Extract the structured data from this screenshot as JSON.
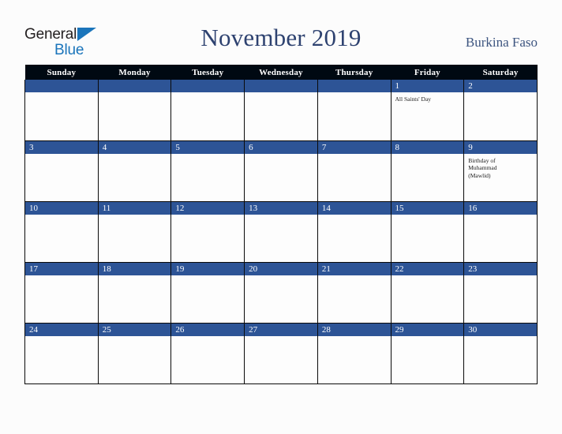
{
  "header": {
    "logo": {
      "word_general": "General",
      "word_blue": "Blue",
      "triangle_icon": "blue-triangle-icon",
      "colors": {
        "general": "#231f20",
        "blue": "#1b75bb"
      }
    },
    "month_title": "November 2019",
    "country": "Burkina Faso"
  },
  "colors": {
    "header_row_bg": "#000912",
    "date_bar_bg": "#2d5496",
    "title_text": "#2e4270",
    "country_text": "#3d5580",
    "page_bg": "#fcfcfc",
    "cell_bg": "#fdfdfd",
    "grid_line": "#0a0a0a"
  },
  "calendar": {
    "month": "November",
    "year": "2019",
    "weekday_headers": [
      "Sunday",
      "Monday",
      "Tuesday",
      "Wednesday",
      "Thursday",
      "Friday",
      "Saturday"
    ],
    "weeks": [
      [
        {
          "date": "",
          "events": []
        },
        {
          "date": "",
          "events": []
        },
        {
          "date": "",
          "events": []
        },
        {
          "date": "",
          "events": []
        },
        {
          "date": "",
          "events": []
        },
        {
          "date": "1",
          "events": [
            "All Saints' Day"
          ]
        },
        {
          "date": "2",
          "events": []
        }
      ],
      [
        {
          "date": "3",
          "events": []
        },
        {
          "date": "4",
          "events": []
        },
        {
          "date": "5",
          "events": []
        },
        {
          "date": "6",
          "events": []
        },
        {
          "date": "7",
          "events": []
        },
        {
          "date": "8",
          "events": []
        },
        {
          "date": "9",
          "events": [
            "Birthday of",
            "Muhammad",
            "(Mawlid)"
          ]
        }
      ],
      [
        {
          "date": "10",
          "events": []
        },
        {
          "date": "11",
          "events": []
        },
        {
          "date": "12",
          "events": []
        },
        {
          "date": "13",
          "events": []
        },
        {
          "date": "14",
          "events": []
        },
        {
          "date": "15",
          "events": []
        },
        {
          "date": "16",
          "events": []
        }
      ],
      [
        {
          "date": "17",
          "events": []
        },
        {
          "date": "18",
          "events": []
        },
        {
          "date": "19",
          "events": []
        },
        {
          "date": "20",
          "events": []
        },
        {
          "date": "21",
          "events": []
        },
        {
          "date": "22",
          "events": []
        },
        {
          "date": "23",
          "events": []
        }
      ],
      [
        {
          "date": "24",
          "events": []
        },
        {
          "date": "25",
          "events": []
        },
        {
          "date": "26",
          "events": []
        },
        {
          "date": "27",
          "events": []
        },
        {
          "date": "28",
          "events": []
        },
        {
          "date": "29",
          "events": []
        },
        {
          "date": "30",
          "events": []
        }
      ]
    ]
  }
}
